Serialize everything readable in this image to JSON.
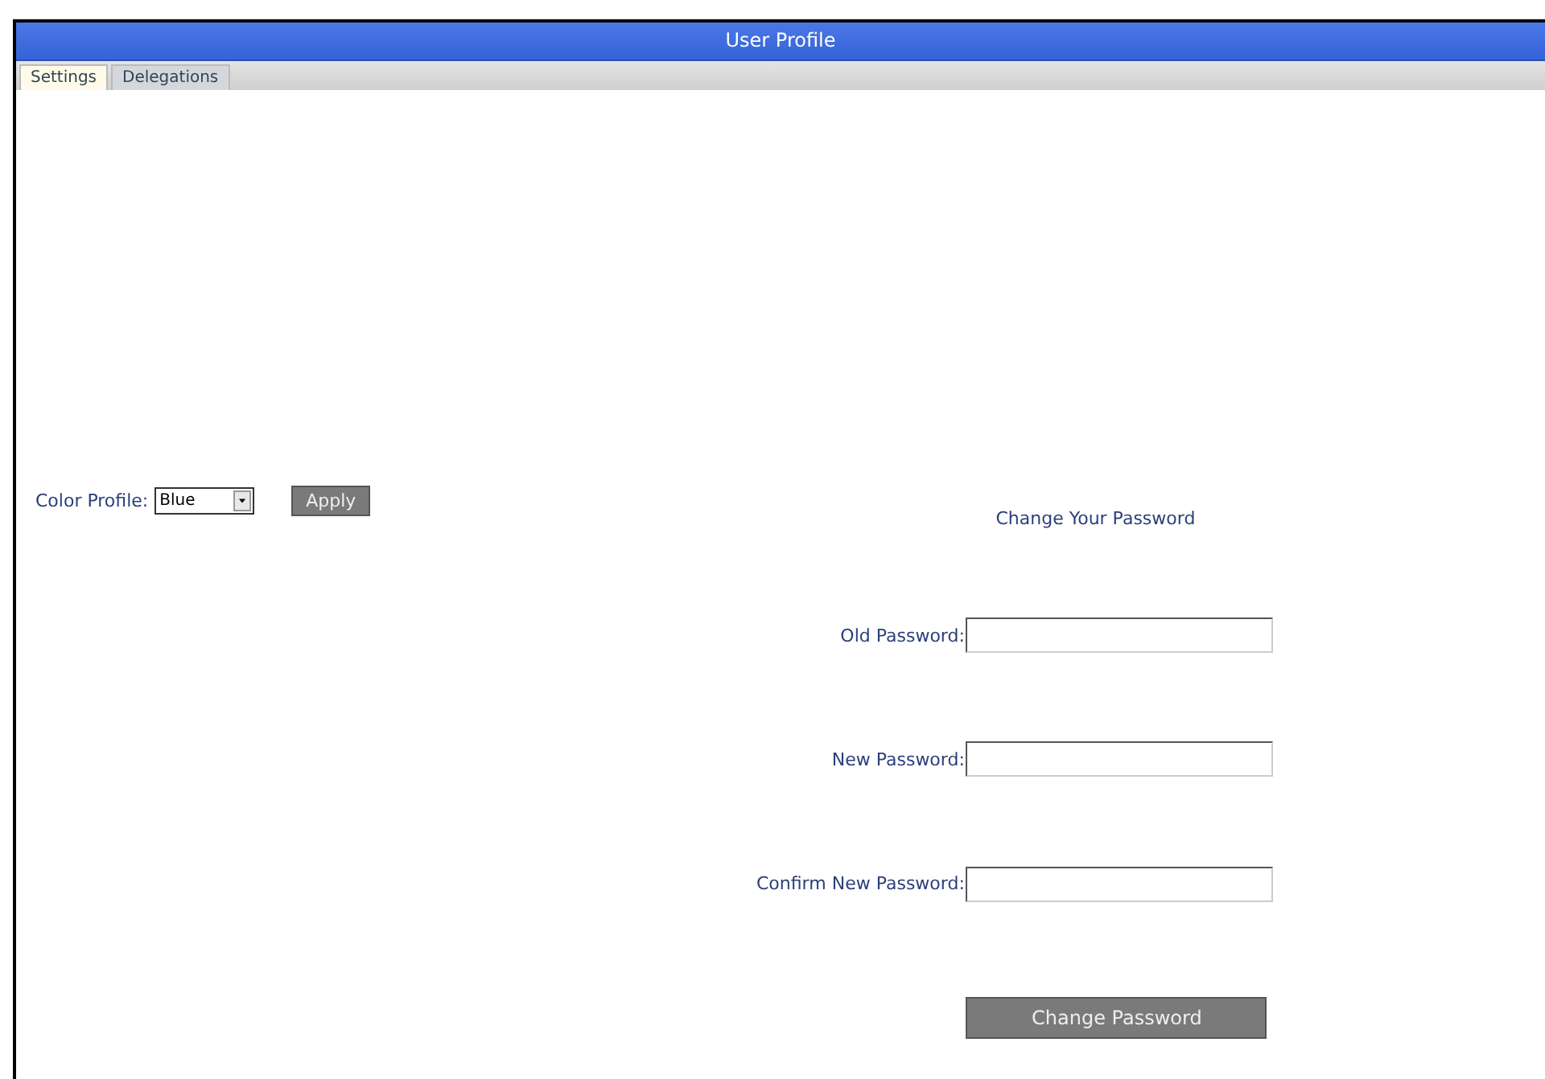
{
  "window": {
    "title": "User Profile"
  },
  "tabs": [
    {
      "label": "Settings",
      "selected": true
    },
    {
      "label": "Delegations",
      "selected": false
    }
  ],
  "color_profile": {
    "label": "Color Profile:",
    "value": "Blue",
    "button": "Apply"
  },
  "change_password": {
    "title": "Change Your Password",
    "fields": [
      {
        "label": "Old Password:"
      },
      {
        "label": "New Password:"
      },
      {
        "label": "Confirm New Password:"
      }
    ],
    "button": "Change Password"
  }
}
